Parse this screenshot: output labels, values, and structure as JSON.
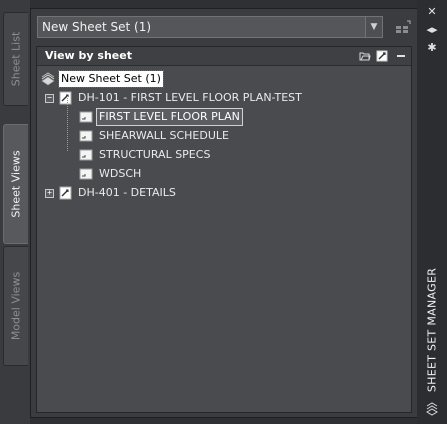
{
  "side_tabs": [
    {
      "label": "Sheet List",
      "active": false
    },
    {
      "label": "Sheet Views",
      "active": true
    },
    {
      "label": "Model Views",
      "active": false
    }
  ],
  "sheet_set_dropdown": {
    "value": "New Sheet Set (1)"
  },
  "panel": {
    "title": "View by sheet"
  },
  "tree": {
    "root": {
      "label": "New Sheet Set (1)"
    },
    "sheets": [
      {
        "label": "DH-101 - FIRST LEVEL FLOOR PLAN-TEST",
        "expanded": true,
        "views": [
          {
            "label": "FIRST LEVEL FLOOR PLAN"
          },
          {
            "label": "SHEARWALL SCHEDULE"
          },
          {
            "label": "STRUCTURAL SPECS"
          },
          {
            "label": "WDSCH"
          }
        ]
      },
      {
        "label": "DH-401 - DETAILS",
        "expanded": false,
        "views": []
      }
    ]
  },
  "palette_title": "SHEET SET MANAGER",
  "icons": {
    "expand": "plus-box-icon",
    "collapse": "minus-box-icon",
    "sheet": "sheet-icon",
    "view": "view-icon",
    "sheet_set": "sheet-set-icon"
  },
  "colors": {
    "background": "#2f3033",
    "panel": "#4a4b4f",
    "text": "#eaeaea",
    "selected_bg": "#ffffff"
  }
}
